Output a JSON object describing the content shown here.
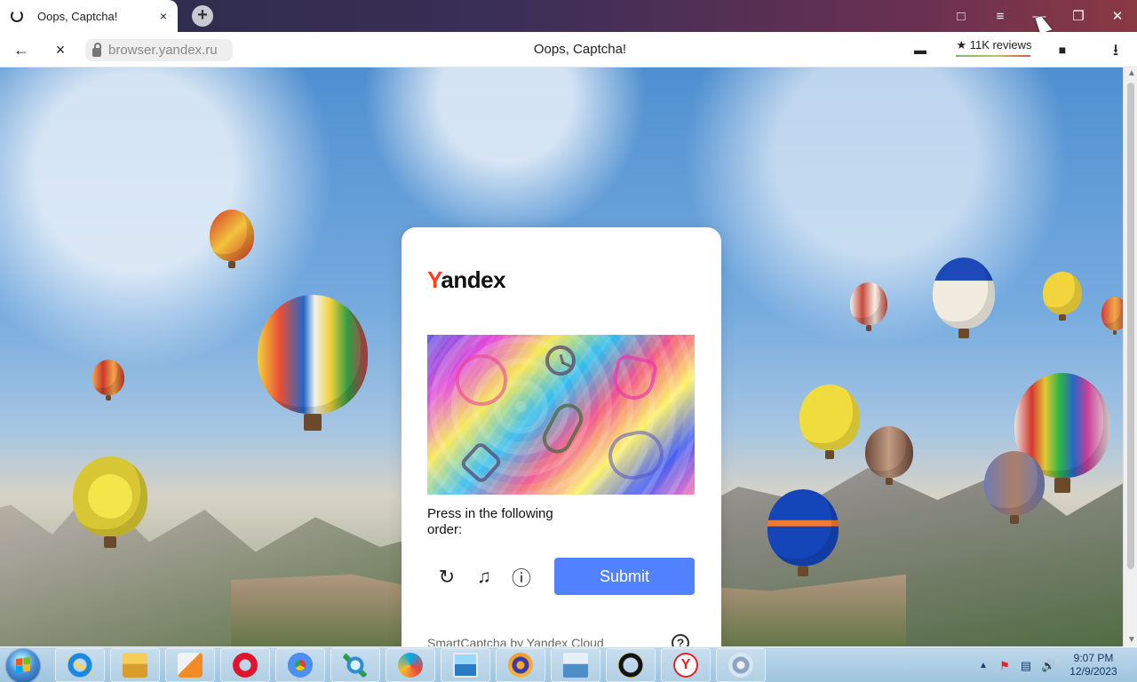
{
  "browser": {
    "tab": {
      "title": "Oops, Captcha!",
      "close_icon": "×",
      "loading_icon": "loading-icon"
    },
    "new_tab_icon": "+",
    "address": {
      "domain": "browser.yandex.ru",
      "lock_icon": "lock-icon"
    },
    "page_title": "Oops, Captcha!",
    "reviews": "★ 11K reviews",
    "icons": {
      "back": "←",
      "stop": "×",
      "chat": "▬",
      "bookmark": "■",
      "download": "⭳",
      "tabs_menu": "□",
      "menu": "≡",
      "minimize": "—",
      "restore": "❐",
      "close": "✕"
    }
  },
  "captcha": {
    "brand_first_letter": "Y",
    "brand_rest": "andex",
    "instruction": "Press in the following order:",
    "actions": {
      "refresh": "↻",
      "audio": "♫",
      "info": "ⓘ"
    },
    "submit": "Submit",
    "footer": "SmartCaptcha by Yandex Cloud",
    "help": "?",
    "image_icons": [
      "circle-face-icon",
      "clock-icon",
      "heart-icon",
      "capsule-icon",
      "key-icon",
      "mitt-icon"
    ]
  },
  "taskbar": {
    "clock_time": "9:07 PM",
    "clock_date": "12/9/2023",
    "icons": [
      "internet-explorer-icon",
      "folder-icon",
      "media-player-icon",
      "opera-icon",
      "chrome-icon",
      "network-icon",
      "vpn-icon",
      "photo-viewer-icon",
      "loop-icon",
      "remote-desktop-icon",
      "support-icon",
      "yandex-icon",
      "disk-icon"
    ],
    "yandex_icon_letter": "Y",
    "tray_icons": {
      "arrow": "▲",
      "flag": "⚑",
      "network": "▤",
      "volume": "🔊"
    }
  },
  "colors": {
    "accent": "#5282ff",
    "yandex_red": "#fc3f1d",
    "taskbar": "#9fc5df"
  }
}
